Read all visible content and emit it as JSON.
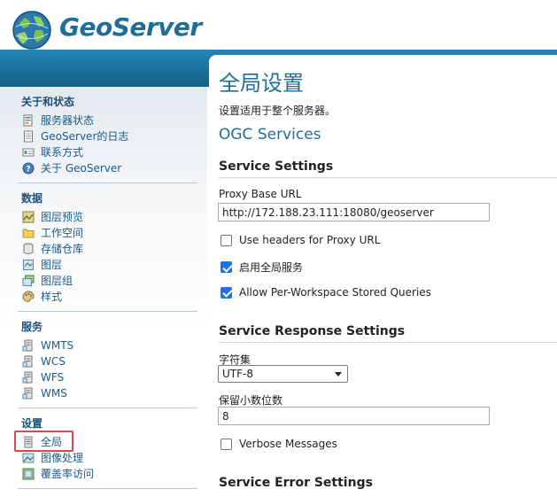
{
  "header": {
    "logo_text": "GeoServer"
  },
  "sidebar": {
    "sections": [
      {
        "title": "关于和状态",
        "items": [
          {
            "label": "服务器状态",
            "icon": "server-status-icon"
          },
          {
            "label": "GeoServer的日志",
            "icon": "log-document-icon"
          },
          {
            "label": "联系方式",
            "icon": "contact-card-icon"
          },
          {
            "label": "关于 GeoServer",
            "icon": "about-globe-icon"
          }
        ]
      },
      {
        "title": "数据",
        "items": [
          {
            "label": "图层预览",
            "icon": "layer-preview-icon"
          },
          {
            "label": "工作空间",
            "icon": "folder-icon"
          },
          {
            "label": "存储仓库",
            "icon": "database-icon"
          },
          {
            "label": "图层",
            "icon": "layer-icon"
          },
          {
            "label": "图层组",
            "icon": "layer-group-icon"
          },
          {
            "label": "样式",
            "icon": "palette-icon"
          }
        ]
      },
      {
        "title": "服务",
        "items": [
          {
            "label": "WMTS",
            "icon": "service-server-icon"
          },
          {
            "label": "WCS",
            "icon": "service-server-icon"
          },
          {
            "label": "WFS",
            "icon": "service-server-icon"
          },
          {
            "label": "WMS",
            "icon": "service-server-icon"
          }
        ]
      },
      {
        "title": "设置",
        "items": [
          {
            "label": "全局",
            "icon": "global-server-icon",
            "selected": true
          },
          {
            "label": "图像处理",
            "icon": "image-processing-icon"
          },
          {
            "label": "覆盖率访问",
            "icon": "coverage-access-icon"
          }
        ]
      }
    ]
  },
  "main": {
    "title": "全局设置",
    "description": "设置适用于整个服务器。",
    "ogc_title": "OGC Services",
    "service_settings": {
      "heading": "Service Settings",
      "proxy_label": "Proxy Base URL",
      "proxy_value": "http://172.188.23.111:18080/geoserver",
      "use_headers_label": "Use headers for Proxy URL",
      "use_headers_checked": false,
      "enable_global_label": "启用全局服务",
      "enable_global_checked": true,
      "per_workspace_label": "Allow Per-Workspace Stored Queries",
      "per_workspace_checked": true
    },
    "response_settings": {
      "heading": "Service Response Settings",
      "charset_label": "字符集",
      "charset_value": "UTF-8",
      "decimals_label": "保留小数位数",
      "decimals_value": "8",
      "verbose_label": "Verbose Messages",
      "verbose_checked": false
    },
    "error_settings": {
      "heading": "Service Error Settings"
    }
  },
  "colors": {
    "brand_blue": "#1f6e9a",
    "band_blue": "#1a6f9b",
    "link_blue": "#1c5a8a",
    "highlight_red": "#e0474c",
    "checkbox_blue": "#1a73e8"
  }
}
